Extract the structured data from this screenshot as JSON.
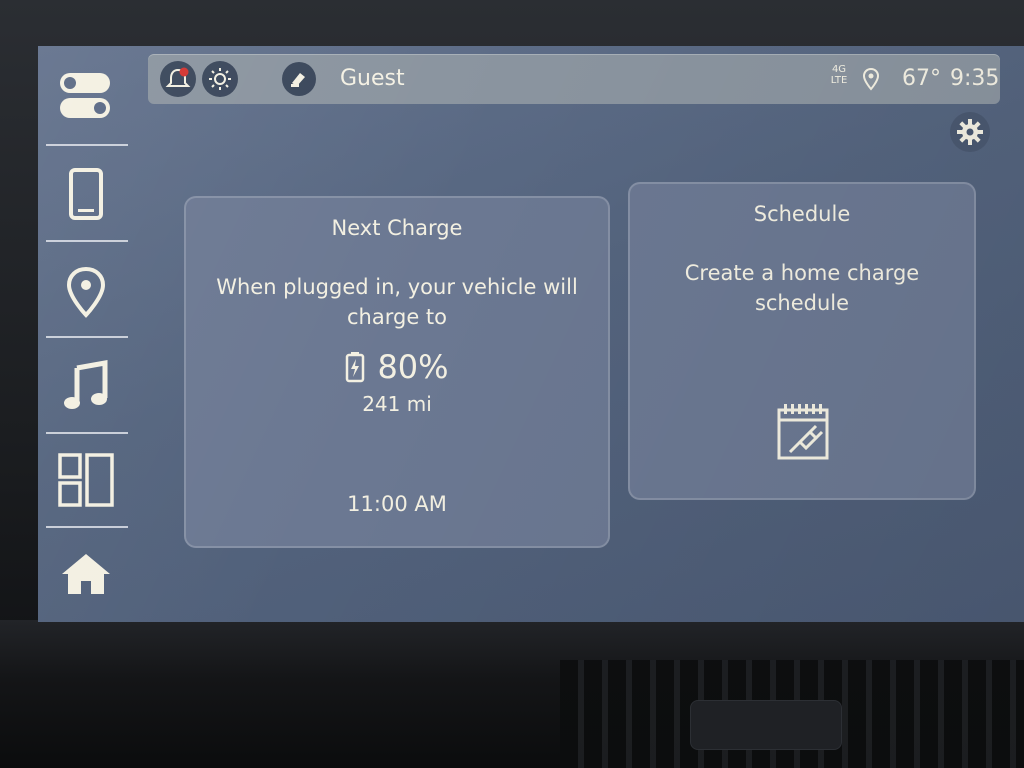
{
  "statusbar": {
    "profile_name": "Guest",
    "network": "4G LTE",
    "temperature": "67°",
    "clock": "9:35",
    "icons": [
      "notification-bell-icon",
      "brightness-icon",
      "profile-icon",
      "network-icon",
      "location-pin-icon"
    ]
  },
  "rail": {
    "items": [
      {
        "name": "controls",
        "icon": "toggle-switches-icon"
      },
      {
        "name": "phone",
        "icon": "phone-icon"
      },
      {
        "name": "navigation",
        "icon": "location-pin-icon"
      },
      {
        "name": "audio",
        "icon": "music-note-icon"
      },
      {
        "name": "apps",
        "icon": "app-grid-icon"
      },
      {
        "name": "home",
        "icon": "home-icon"
      }
    ]
  },
  "next_charge": {
    "title": "Next Charge",
    "message": "When plugged in, your vehicle will charge to",
    "target_percent": "80%",
    "range": "241 mi",
    "time": "11:00 AM",
    "icon": "battery-charging-icon"
  },
  "schedule": {
    "title": "Schedule",
    "message": "Create a home charge schedule",
    "icon": "calendar-plug-icon"
  },
  "settings": {
    "icon": "gear-icon"
  },
  "colors": {
    "screen": "#5a6984",
    "card": "#6b7892",
    "statusbar": "#8a949f",
    "text": "#f3f0e2"
  }
}
